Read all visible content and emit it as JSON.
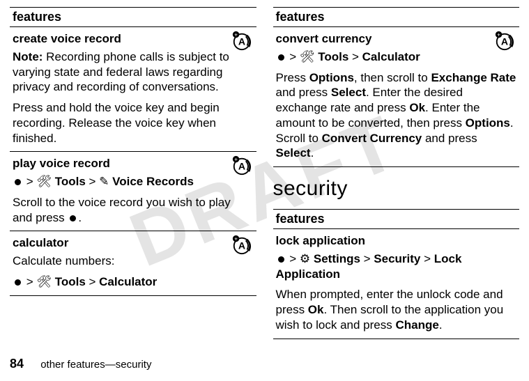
{
  "watermark": "DRAFT",
  "left": {
    "header": "features",
    "rows": [
      {
        "title": "create voice record",
        "emblem": true,
        "p1_label": "Note:",
        "p1_rest": " Recording phone calls is subject to varying state and federal laws regarding privacy and recording of conversations.",
        "p2": "Press and hold the voice key and begin recording. Release the voice key when finished."
      },
      {
        "title": "play voice record",
        "emblem": true,
        "nav_tools": "Tools",
        "nav_pencil": "✎",
        "nav_target": "Voice Records",
        "p2_a": "Scroll to the voice record you wish to play and press ",
        "p2_b": "."
      },
      {
        "title": "calculator",
        "emblem": true,
        "p1": "Calculate numbers:",
        "nav_tools": "Tools",
        "nav_target": "Calculator"
      }
    ]
  },
  "right_top": {
    "header": "features",
    "row": {
      "title": "convert currency",
      "emblem": true,
      "nav_tools": "Tools",
      "nav_target": "Calculator",
      "p_a": "Press ",
      "p_b": "Options",
      "p_c": ", then scroll to ",
      "p_d": "Exchange Rate",
      "p_e": " and press ",
      "p_f": "Select",
      "p_g": ". Enter the desired exchange rate and press ",
      "p_h": "Ok",
      "p_i": ". Enter the amount to be converted, then press ",
      "p_j": "Options",
      "p_k": ". Scroll to ",
      "p_l": "Convert Currency",
      "p_m": " and press ",
      "p_n": "Select",
      "p_o": "."
    }
  },
  "security_heading": "security",
  "right_bot": {
    "header": "features",
    "row": {
      "title": "lock application",
      "nav_settings_glyph": "⚙",
      "nav_settings": "Settings",
      "nav_security": "Security",
      "nav_target": "Lock Application",
      "p_a": "When prompted, enter the unlock code and press ",
      "p_b": "Ok",
      "p_c": ". Then scroll to the application you wish to lock and press ",
      "p_d": "Change",
      "p_e": "."
    }
  },
  "footer": {
    "page": "84",
    "text": "other features—security"
  },
  "icons": {
    "tools_glyph": "🛠"
  }
}
